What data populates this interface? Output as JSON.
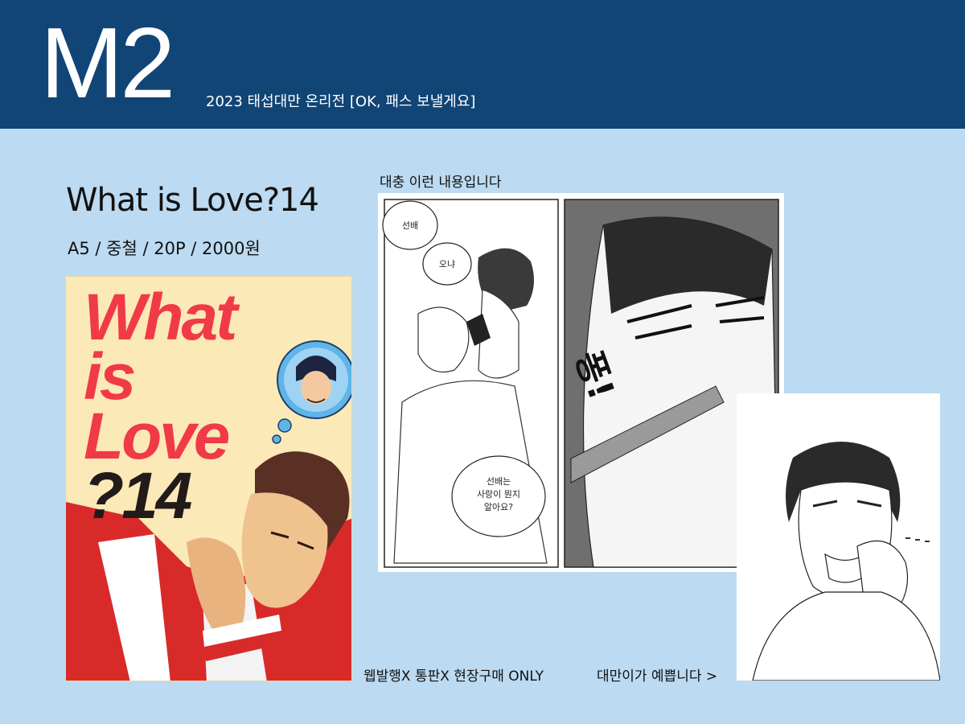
{
  "header": {
    "booth": "M2",
    "event": "2023 태섭대만 온리전 [OK, 패스 보낼게요]"
  },
  "book": {
    "title": "What is Love?14",
    "specs": "A5 / 중철 / 20P / 2000원"
  },
  "cover": {
    "line1": "What",
    "line2": "is",
    "line3": "Love",
    "line4": "?14",
    "colors": {
      "background": "#fbe9b8",
      "title": "#f03a47",
      "jacket": "#d92a2a"
    }
  },
  "sample": {
    "caption": "대충 이런 내용입니다",
    "bubbles": [
      "선배",
      "오냐",
      "선배는",
      "사랑이 뭔지",
      "알아요?"
    ],
    "sfx": "퐁!"
  },
  "notes": {
    "sale": "웹발행X 통판X 현장구매 ONLY",
    "cute": "대만이가 예쁩니다 >"
  },
  "colors": {
    "header": "#104576",
    "background": "#bcdaf1"
  }
}
